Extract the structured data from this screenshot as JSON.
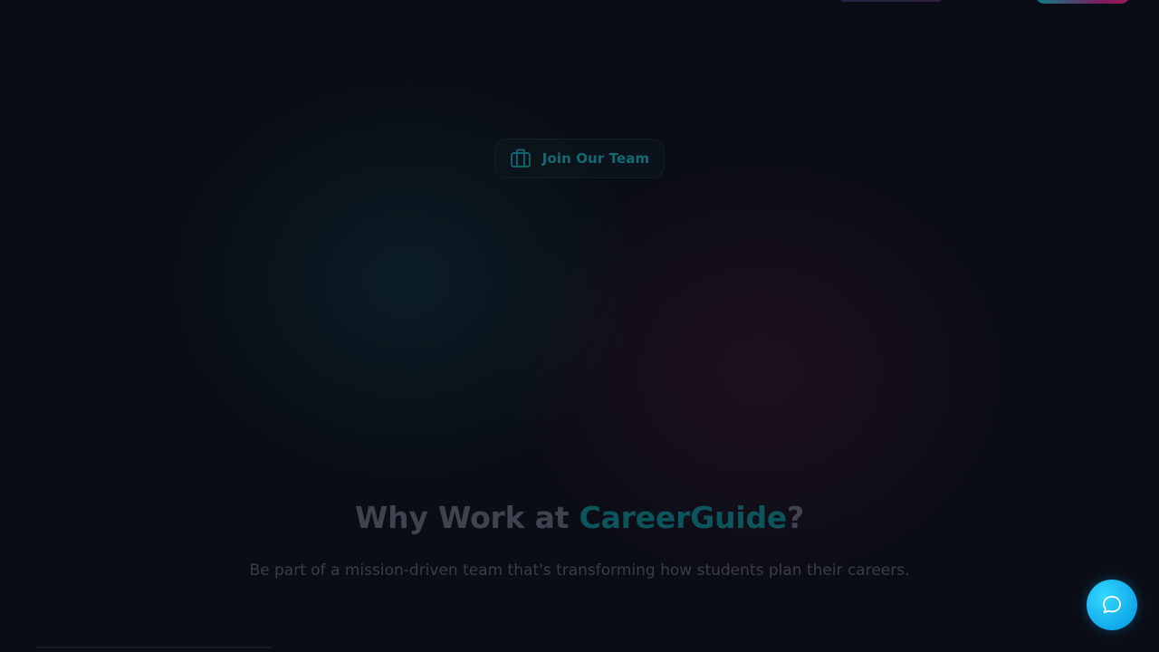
{
  "badge": {
    "label": "Join Our Team",
    "icon": "briefcase-icon"
  },
  "section": {
    "title_prefix": "Why Work at ",
    "title_accent": "CareerGuide",
    "title_suffix": "?",
    "subtitle": "Be part of a mission-driven team that's transforming how students plan their careers."
  },
  "chat": {
    "icon": "chat-bubble-icon"
  },
  "colors": {
    "background": "#0a0d16",
    "accent_teal": "#126b73",
    "heading": "#3f4350",
    "chat_button": "#11a9ea"
  }
}
